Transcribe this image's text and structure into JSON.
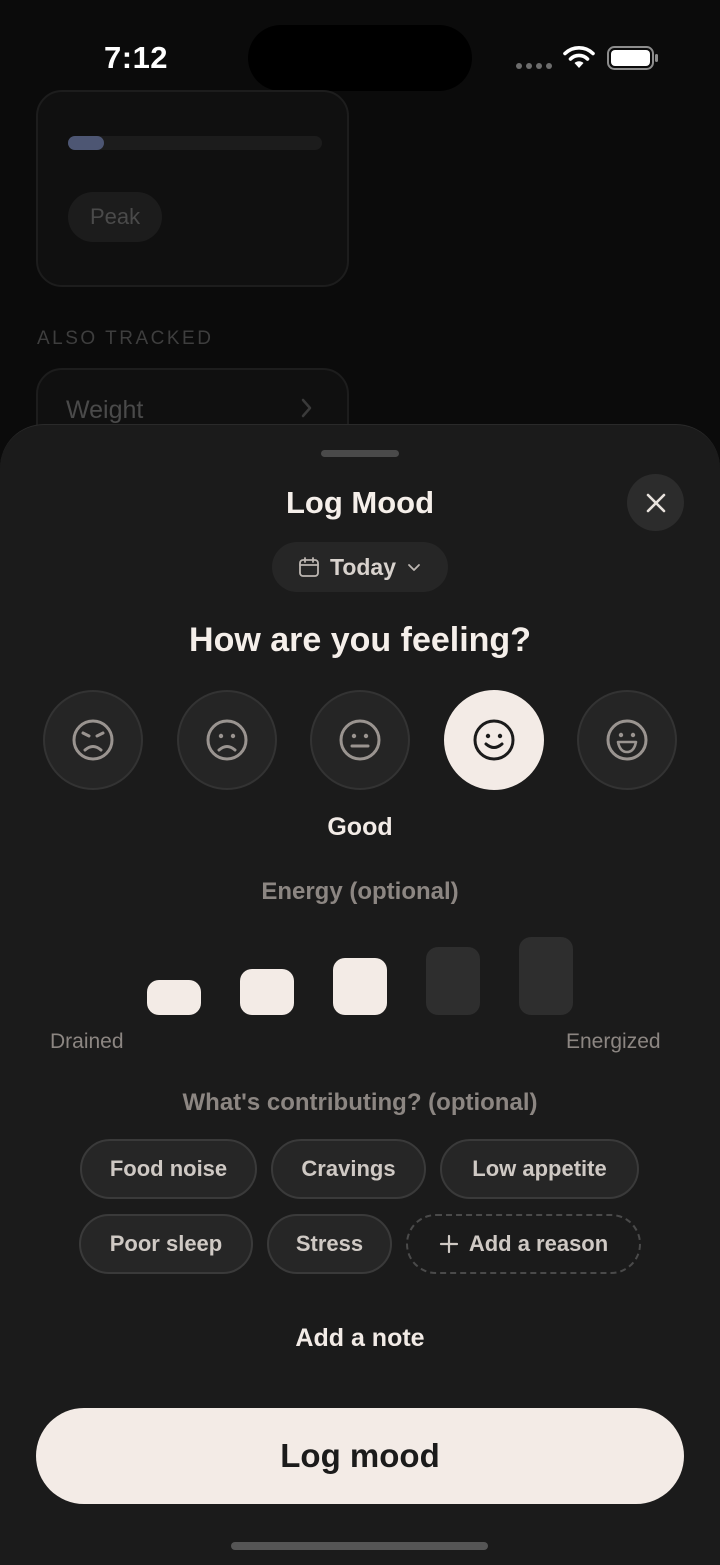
{
  "status_bar": {
    "time": "7:12"
  },
  "background": {
    "card_progress": 0.14,
    "card_chip": "Peak",
    "section_label": "ALSO TRACKED",
    "row_label": "Weight"
  },
  "sheet": {
    "title": "Log Mood",
    "date": "Today",
    "question": "How are you feeling?",
    "moods": [
      {
        "icon": "angry-face-icon",
        "selected": false
      },
      {
        "icon": "sad-face-icon",
        "selected": false
      },
      {
        "icon": "neutral-face-icon",
        "selected": false
      },
      {
        "icon": "smile-face-icon",
        "selected": true
      },
      {
        "icon": "grin-face-icon",
        "selected": false
      }
    ],
    "selected_mood_label": "Good",
    "energy": {
      "title": "Energy (optional)",
      "low_label": "Drained",
      "high_label": "Energized",
      "selected_level": 3,
      "max_level": 5
    },
    "contributing": {
      "title": "What's contributing? (optional)",
      "chips": [
        "Food noise",
        "Cravings",
        "Low appetite",
        "Poor sleep",
        "Stress"
      ],
      "add_label": "Add a reason"
    },
    "add_note": "Add a note",
    "submit": "Log mood"
  },
  "colors": {
    "sheet_bg": "#1b1b1b",
    "accent": "#f3ebe6",
    "muted_text": "#8c8682"
  }
}
